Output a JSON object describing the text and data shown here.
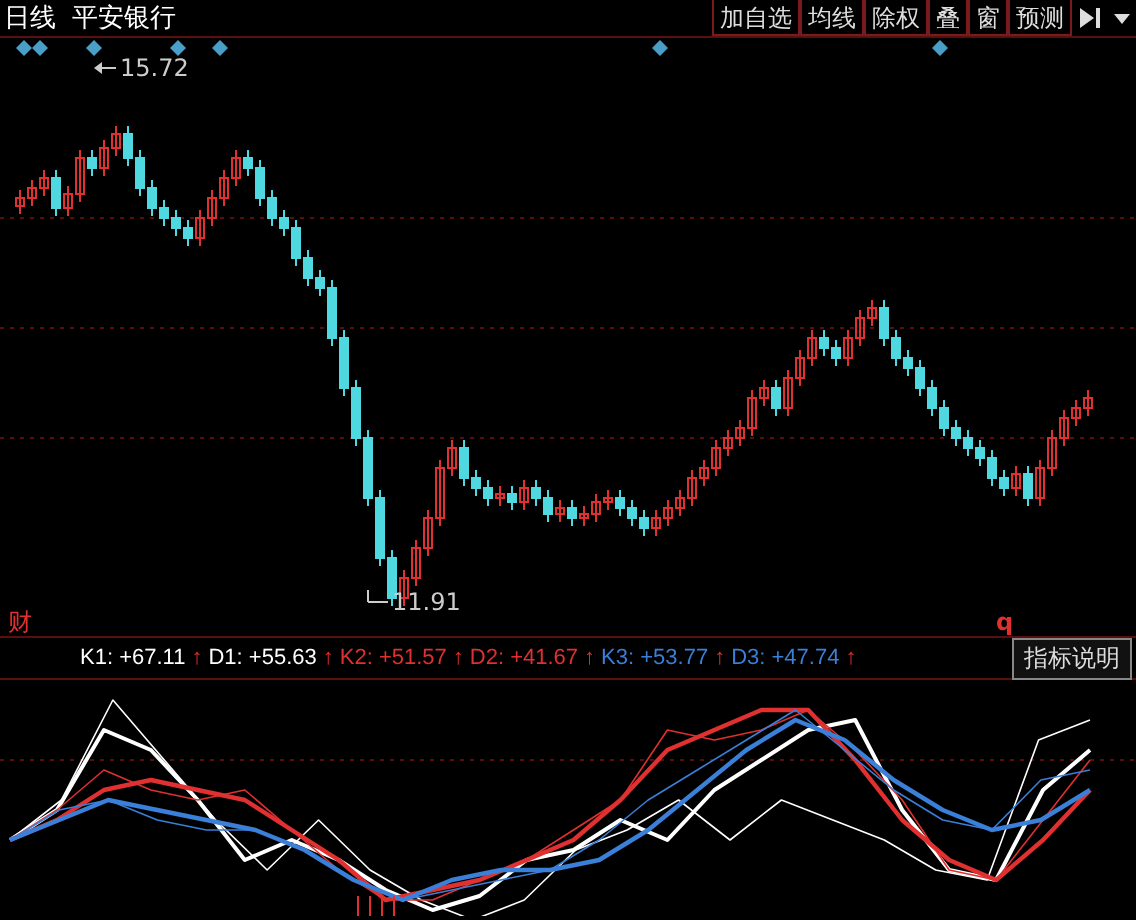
{
  "header": {
    "period": "日线",
    "stock": "平安银行"
  },
  "toolbar": [
    {
      "label": "加自选"
    },
    {
      "label": "均线"
    },
    {
      "label": "除权"
    },
    {
      "label": "叠"
    },
    {
      "label": "窗"
    },
    {
      "label": "预测"
    }
  ],
  "price_labels": [
    {
      "kind": "high",
      "value": "15.72"
    },
    {
      "kind": "low",
      "value": "11.91"
    }
  ],
  "finance_mark": "财",
  "event_mark": "q",
  "indicators": [
    {
      "name": "K1:",
      "value": "+67.11",
      "arrow": "↑",
      "color": "#ffffff"
    },
    {
      "name": "D1:",
      "value": "+55.63",
      "arrow": "↑",
      "color": "#ffffff"
    },
    {
      "name": "K2:",
      "value": "+51.57",
      "arrow": "↑",
      "color": "#e03030"
    },
    {
      "name": "D2:",
      "value": "+41.67",
      "arrow": "↑",
      "color": "#e03030"
    },
    {
      "name": "K3:",
      "value": "+53.77",
      "arrow": "↑",
      "color": "#3a7fd8"
    },
    {
      "name": "D3:",
      "value": "+47.74",
      "arrow": "↑",
      "color": "#3a7fd8"
    }
  ],
  "help_button": "指标说明"
}
